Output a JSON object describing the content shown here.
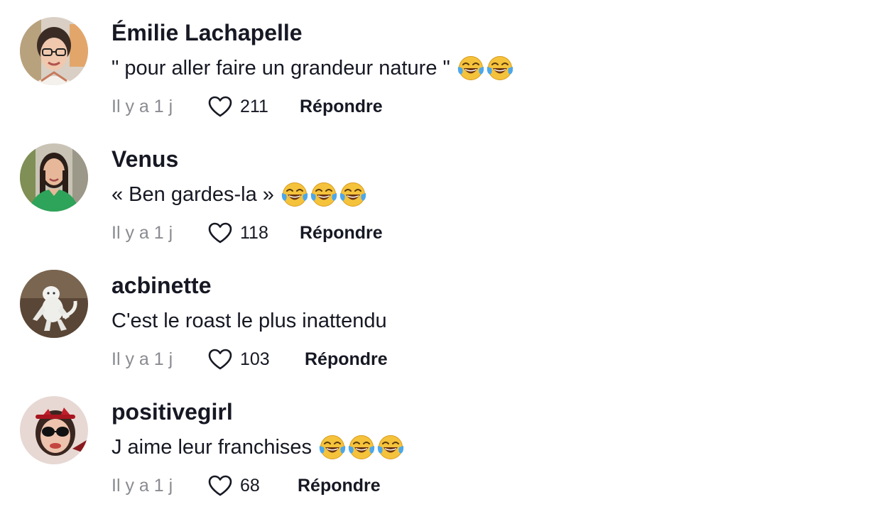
{
  "comments": [
    {
      "username": "Émilie Lachapelle",
      "text": "\" pour aller faire un grandeur nature \"",
      "emoji_count": 2,
      "time": "Il y a 1 j",
      "likes": "211",
      "reply_label": "Répondre",
      "avatar": "avatar-woman-glasses"
    },
    {
      "username": "Venus",
      "text": "« Ben gardes-la »",
      "emoji_count": 3,
      "time": "Il y a 1 j",
      "likes": "118",
      "reply_label": "Répondre",
      "avatar": "avatar-woman-green-shirt"
    },
    {
      "username": "acbinette",
      "text": "C'est le roast le plus inattendu",
      "emoji_count": 0,
      "time": "Il y a 1 j",
      "likes": "103",
      "reply_label": "Répondre",
      "avatar": "avatar-white-yeti-figure"
    },
    {
      "username": "positivegirl",
      "text": "J aime leur franchises",
      "emoji_count": 3,
      "time": "Il y a 1 j",
      "likes": "68",
      "reply_label": "Répondre",
      "avatar": "avatar-woman-red-headband"
    }
  ],
  "icons": {
    "like": "heart-outline-icon",
    "emoji": "face-with-tears-of-joy-emoji"
  },
  "colors": {
    "text": "#161823",
    "muted": "#8a8b91",
    "heart_stroke": "#161823",
    "emoji_face": "#F5C33B"
  }
}
